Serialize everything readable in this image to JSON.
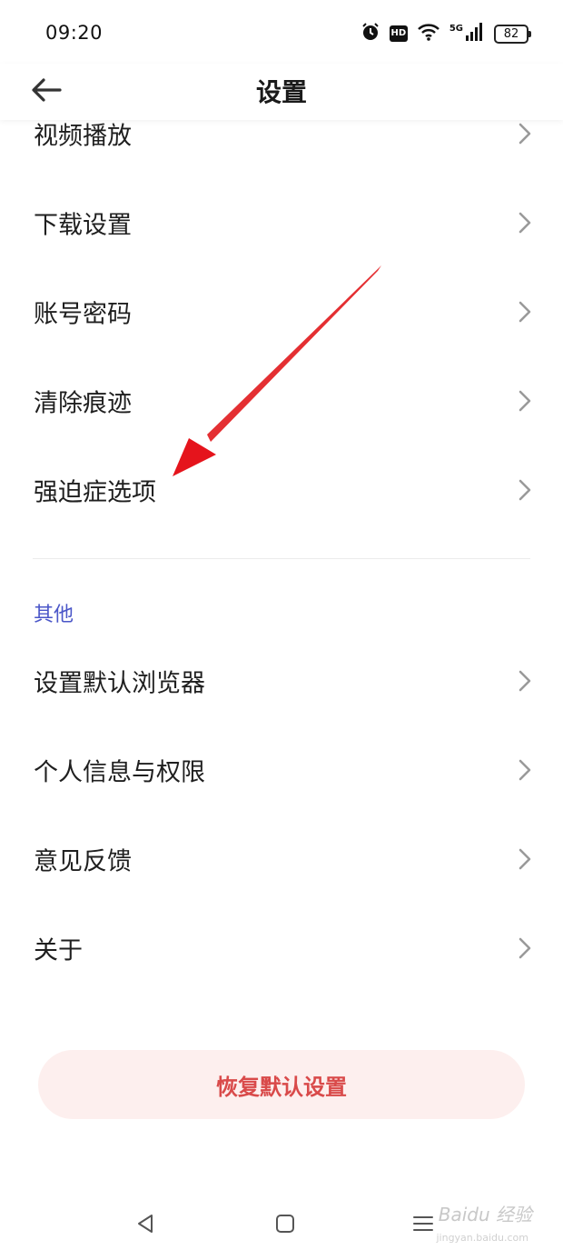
{
  "status": {
    "time": "09:20",
    "hd": "HD",
    "network": "5G",
    "battery": "82"
  },
  "header": {
    "title": "设置"
  },
  "settings": {
    "items": [
      {
        "label": "视频播放"
      },
      {
        "label": "下载设置"
      },
      {
        "label": "账号密码"
      },
      {
        "label": "清除痕迹"
      },
      {
        "label": "强迫症选项"
      }
    ]
  },
  "other": {
    "section_title": "其他",
    "items": [
      {
        "label": "设置默认浏览器"
      },
      {
        "label": "个人信息与权限"
      },
      {
        "label": "意见反馈"
      },
      {
        "label": "关于"
      }
    ]
  },
  "reset_button": {
    "label": "恢复默认设置"
  },
  "watermark": {
    "text": "Baidu 经验",
    "sub": "jingyan.baidu.com"
  },
  "colors": {
    "accent": "#4a56c8",
    "danger_text": "#d94a4a",
    "danger_bg": "#fdefee",
    "annotation_arrow": "#e5141c"
  },
  "icons": {
    "back": "arrow-left-icon",
    "chevron": "chevron-right-icon",
    "alarm": "alarm-icon",
    "wifi": "wifi-icon",
    "signal": "signal-icon",
    "nav_back": "triangle-back-icon",
    "nav_home": "square-home-icon",
    "nav_menu": "menu-icon"
  }
}
